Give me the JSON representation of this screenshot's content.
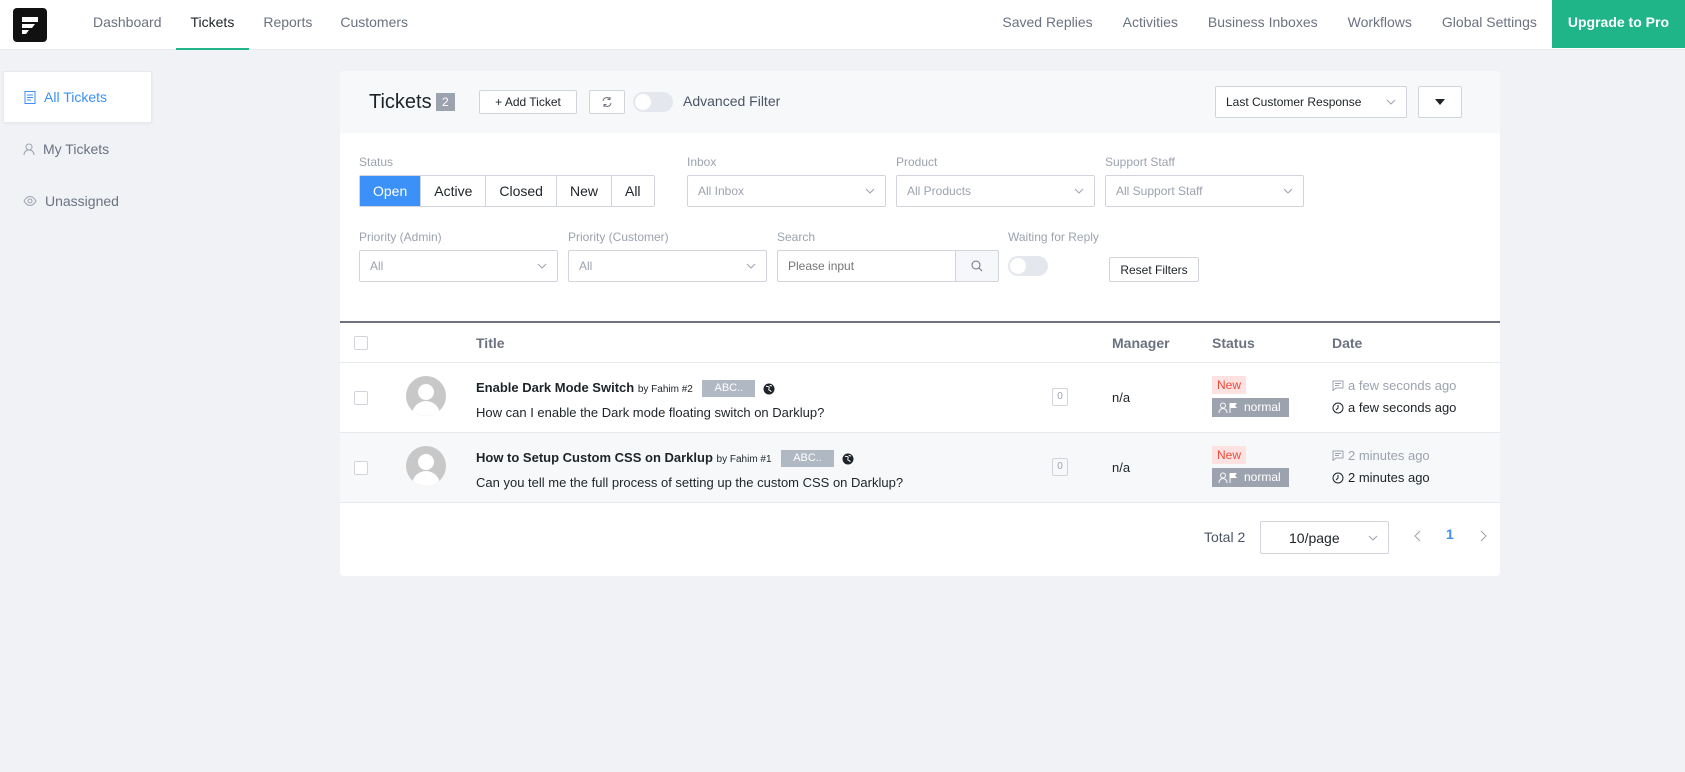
{
  "topnav": {
    "left": [
      "Dashboard",
      "Tickets",
      "Reports",
      "Customers"
    ],
    "right": [
      "Saved Replies",
      "Activities",
      "Business Inboxes",
      "Workflows",
      "Global Settings"
    ],
    "upgrade": "Upgrade to Pro"
  },
  "sidebar": {
    "items": [
      "All Tickets",
      "My Tickets",
      "Unassigned"
    ]
  },
  "header": {
    "title": "Tickets",
    "count": "2",
    "add_ticket": "+ Add Ticket",
    "advanced_filter": "Advanced Filter",
    "sort": "Last Customer Response"
  },
  "filters": {
    "status_label": "Status",
    "status_options": [
      "Open",
      "Active",
      "Closed",
      "New",
      "All"
    ],
    "inbox_label": "Inbox",
    "inbox_value": "All Inbox",
    "product_label": "Product",
    "product_value": "All Products",
    "staff_label": "Support Staff",
    "staff_value": "All Support Staff",
    "priority_admin_label": "Priority (Admin)",
    "priority_admin_value": "All",
    "priority_customer_label": "Priority (Customer)",
    "priority_customer_value": "All",
    "search_label": "Search",
    "search_placeholder": "Please input",
    "waiting_label": "Waiting for Reply",
    "reset": "Reset Filters"
  },
  "table": {
    "columns": [
      "Title",
      "Manager",
      "Status",
      "Date"
    ],
    "rows": [
      {
        "title": "Enable Dark Mode Switch",
        "by": "by Fahim #2",
        "tag": "ABC..",
        "desc": "How can I enable the Dark mode floating switch on Darklup?",
        "count": "0",
        "manager": "n/a",
        "status": "New",
        "priority": "normal",
        "date1": "a few seconds ago",
        "date2": "a few seconds ago"
      },
      {
        "title": "How to Setup Custom CSS on Darklup",
        "by": "by Fahim #1",
        "tag": "ABC..",
        "desc": "Can you tell me the full process of setting up the custom CSS on Darklup?",
        "count": "0",
        "manager": "n/a",
        "status": "New",
        "priority": "normal",
        "date1": "2 minutes ago",
        "date2": "2 minutes ago"
      }
    ]
  },
  "pagination": {
    "total": "Total 2",
    "page_size": "10/page",
    "current": "1"
  }
}
